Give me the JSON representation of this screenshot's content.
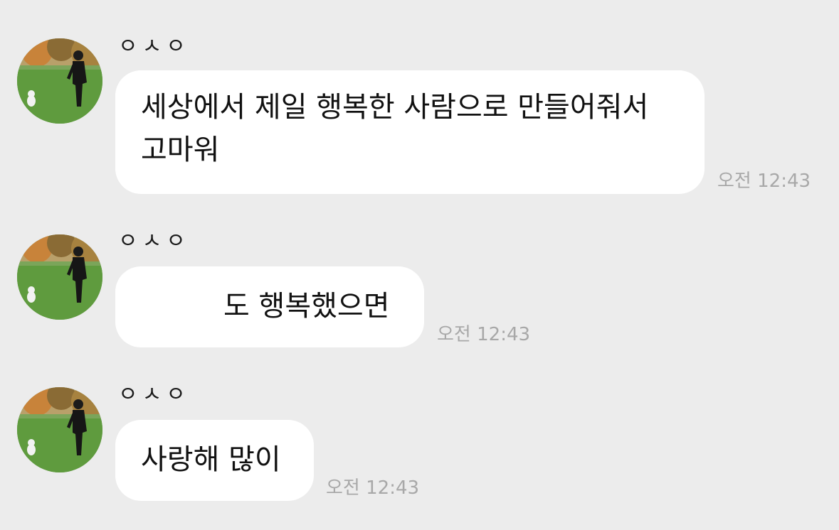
{
  "messages": [
    {
      "sender": "ㅇㅅㅇ",
      "lines": [
        "세상에서 제일 행복한 사람으로 만들어줘서",
        "고마워"
      ],
      "time": "오전 12:43"
    },
    {
      "sender": "ㅇㅅㅇ",
      "lines": [
        "도 행복했으면"
      ],
      "time": "오전 12:43"
    },
    {
      "sender": "ㅇㅅㅇ",
      "lines": [
        "사랑해 많이"
      ],
      "time": "오전 12:43"
    }
  ],
  "colors": {
    "background": "#ececec",
    "bubble": "#ffffff",
    "text": "#111111",
    "timestamp": "#a8a8a8"
  }
}
